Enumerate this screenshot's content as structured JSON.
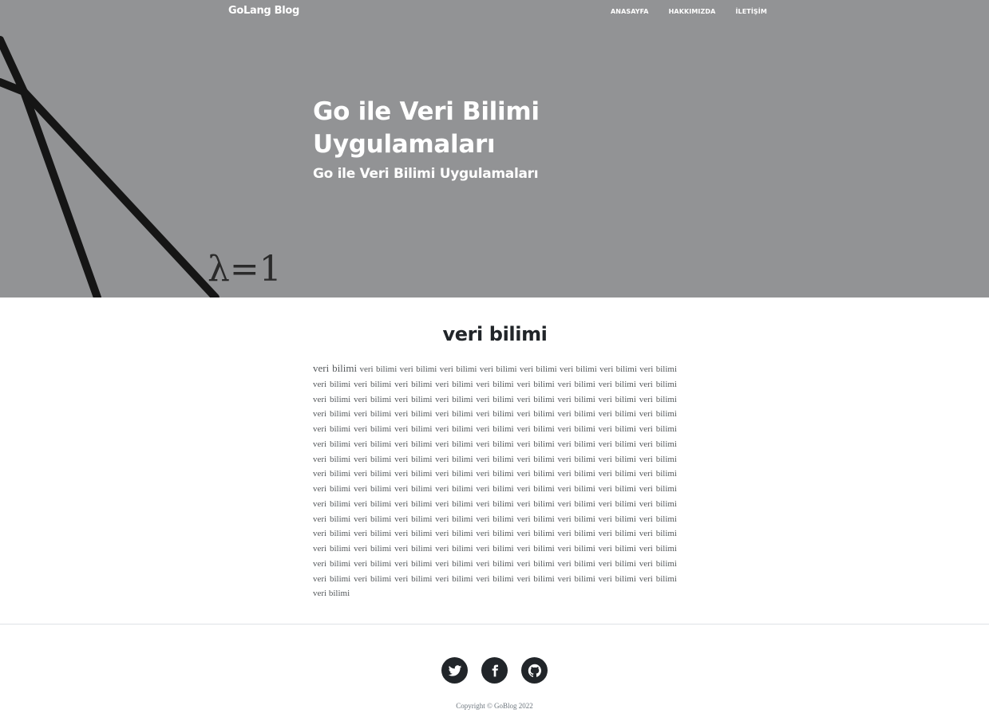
{
  "nav": {
    "brand": "GoLang Blog",
    "links": [
      "ANASAYFA",
      "HAKKIMIZDA",
      "İLETİŞİM"
    ]
  },
  "hero": {
    "image_label": "λ=1",
    "title": "Go ile Veri Bilimi Uygulamaları",
    "subtitle": "Go ile Veri Bilimi Uygulamaları",
    "overlay_color": "#929395"
  },
  "post": {
    "title": "veri bilimi",
    "lead": "veri bilimi",
    "body": "veri bilimi veri bilimi veri bilimi veri bilimi veri bilimi veri bilimi veri bilimi veri bilimi veri bilimi veri bilimi veri bilimi veri bilimi veri bilimi veri bilimi veri bilimi veri bilimi veri bilimi veri bilimi veri bilimi veri bilimi veri bilimi veri bilimi veri bilimi veri bilimi veri bilimi veri bilimi veri bilimi veri bilimi veri bilimi veri bilimi veri bilimi veri bilimi veri bilimi veri bilimi veri bilimi veri bilimi veri bilimi veri bilimi veri bilimi veri bilimi veri bilimi veri bilimi veri bilimi veri bilimi veri bilimi veri bilimi veri bilimi veri bilimi veri bilimi veri bilimi veri bilimi veri bilimi veri bilimi veri bilimi veri bilimi veri bilimi veri bilimi veri bilimi veri bilimi veri bilimi veri bilimi veri bilimi veri bilimi veri bilimi veri bilimi veri bilimi veri bilimi veri bilimi veri bilimi veri bilimi veri bilimi veri bilimi veri bilimi veri bilimi veri bilimi veri bilimi veri bilimi veri bilimi veri bilimi veri bilimi veri bilimi veri bilimi veri bilimi veri bilimi veri bilimi veri bilimi veri bilimi veri bilimi veri bilimi veri bilimi veri bilimi veri bilimi veri bilimi veri bilimi veri bilimi veri bilimi veri bilimi veri bilimi veri bilimi veri bilimi veri bilimi veri bilimi veri bilimi veri bilimi veri bilimi veri bilimi veri bilimi veri bilimi veri bilimi veri bilimi veri bilimi veri bilimi veri bilimi veri bilimi veri bilimi veri bilimi veri bilimi veri bilimi veri bilimi veri bilimi veri bilimi veri bilimi veri bilimi veri bilimi veri bilimi veri bilimi veri bilimi veri bilimi veri bilimi veri bilimi veri bilimi veri bilimi veri bilimi veri bilimi veri bilimi"
  },
  "footer": {
    "social": [
      {
        "name": "twitter-icon"
      },
      {
        "name": "facebook-icon"
      },
      {
        "name": "github-icon"
      }
    ],
    "copyright": "Copyright © GoBlog 2022"
  }
}
